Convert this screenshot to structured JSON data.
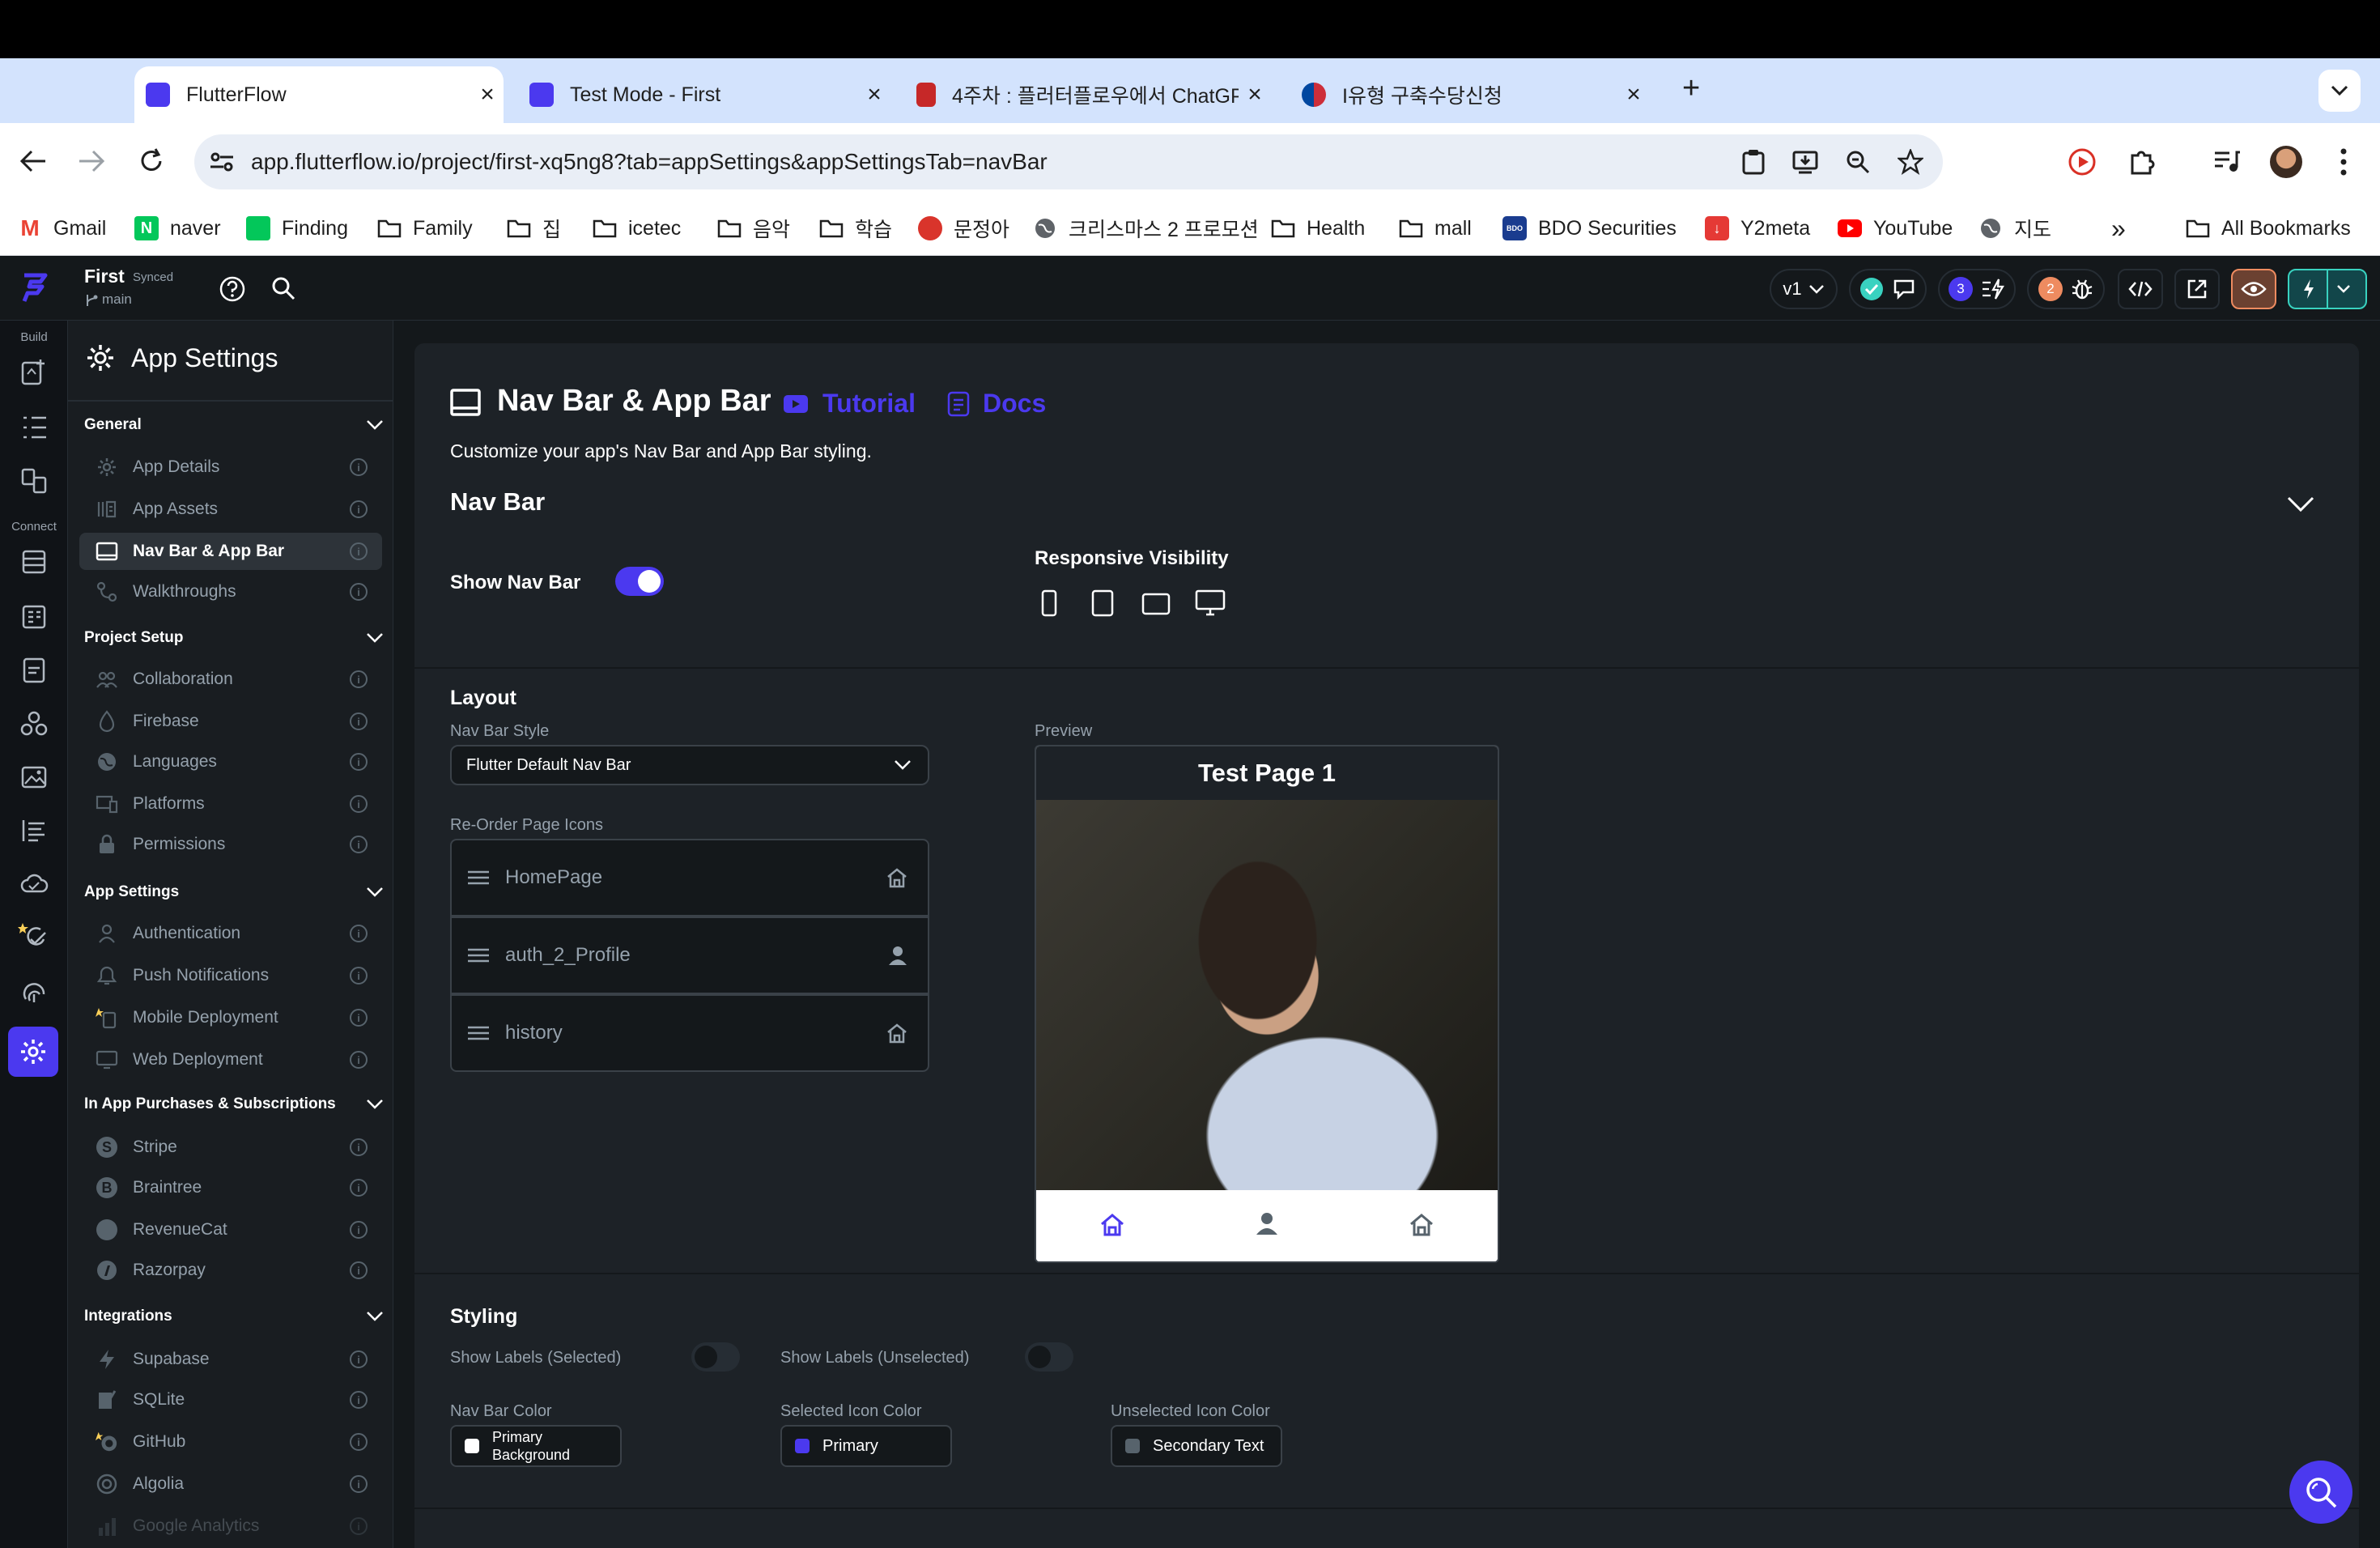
{
  "browser": {
    "tabs": [
      {
        "title": "FlutterFlow",
        "active": true
      },
      {
        "title": "Test Mode - First",
        "active": false
      },
      {
        "title": "4주차 : 플러터플로우에서 ChatGP",
        "active": false
      },
      {
        "title": "I유형 구축수당신청",
        "active": false
      }
    ],
    "new_tab": "+",
    "url": "app.flutterflow.io/project/first-xq5ng8?tab=appSettings&appSettingsTab=navBar",
    "bookmarks": [
      "Gmail",
      "naver",
      "Finding",
      "Family",
      "집",
      "icetec",
      "음악",
      "학습",
      "문정아",
      "크리스마스 2 프로모션",
      "Health",
      "mall",
      "BDO Securities",
      "Y2meta",
      "YouTube",
      "지도"
    ],
    "bookmarks_overflow": "»",
    "all_bookmarks": "All Bookmarks"
  },
  "topbar": {
    "project": "First",
    "sync_status": "Synced",
    "branch": "main",
    "version": "v1",
    "badge_blue": "3",
    "badge_orange": "2"
  },
  "rail": {
    "build": "Build",
    "connect": "Connect"
  },
  "sidebar": {
    "title": "App Settings",
    "sections": [
      {
        "label": "General",
        "items": [
          "App Details",
          "App Assets",
          "Nav Bar & App Bar",
          "Walkthroughs"
        ]
      },
      {
        "label": "Project Setup",
        "items": [
          "Collaboration",
          "Firebase",
          "Languages",
          "Platforms",
          "Permissions"
        ]
      },
      {
        "label": "App Settings",
        "items": [
          "Authentication",
          "Push Notifications",
          "Mobile Deployment",
          "Web Deployment"
        ]
      },
      {
        "label": "In App Purchases & Subscriptions",
        "items": [
          "Stripe",
          "Braintree",
          "RevenueCat",
          "Razorpay"
        ]
      },
      {
        "label": "Integrations",
        "items": [
          "Supabase",
          "SQLite",
          "GitHub",
          "Algolia",
          "Google Analytics"
        ]
      }
    ],
    "info_glyph": "i"
  },
  "main": {
    "title": "Nav Bar & App Bar",
    "tutorial": "Tutorial",
    "docs": "Docs",
    "subtitle": "Customize your app's Nav Bar and App Bar styling.",
    "navbar_heading": "Nav Bar",
    "show_nav_bar": "Show Nav Bar",
    "show_nav_bar_on": true,
    "responsive_visibility": "Responsive Visibility",
    "layout_heading": "Layout",
    "nav_bar_style_label": "Nav Bar Style",
    "nav_bar_style_value": "Flutter Default Nav Bar",
    "reorder_label": "Re-Order Page Icons",
    "pages": [
      {
        "name": "HomePage",
        "icon": "home-icon"
      },
      {
        "name": "auth_2_Profile",
        "icon": "person-icon"
      },
      {
        "name": "history",
        "icon": "home-icon"
      }
    ],
    "preview_label": "Preview",
    "preview_page_title": "Test Page 1",
    "styling_heading": "Styling",
    "show_labels_selected": "Show Labels (Selected)",
    "show_labels_unselected": "Show Labels (Unselected)",
    "nav_bar_color_label": "Nav Bar Color",
    "nav_bar_color_value": "Primary Background",
    "nav_bar_color_line1": "Primary",
    "nav_bar_color_line2": "Background",
    "selected_icon_color_label": "Selected Icon Color",
    "selected_icon_color_value": "Primary",
    "unselected_icon_color_label": "Unselected Icon Color",
    "unselected_icon_color_value": "Secondary Text"
  },
  "colors": {
    "accent": "#4b39ef",
    "app_bg": "#14181b",
    "panel_bg": "#1d2227",
    "secondary_text": "#95a1ac",
    "success": "#39d2c0",
    "orange": "#ee8b60"
  }
}
